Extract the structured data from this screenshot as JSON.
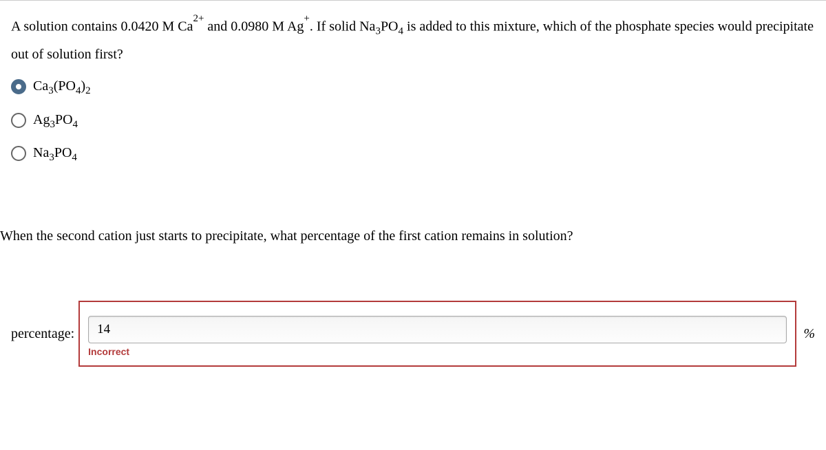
{
  "question1": {
    "prefix": "A solution contains 0.0420 M Ca",
    "sup1": "2+",
    "mid": " and 0.0980 M Ag",
    "sup2": "+",
    "suffix1": ". If solid Na",
    "sub1": "3",
    "suffix2": "PO",
    "sub2": "4",
    "suffix3": " is added to this mixture, which of the phosphate species would precipitate out of solution first?"
  },
  "options": [
    {
      "parts": [
        {
          "text": "Ca",
          "type": "normal"
        },
        {
          "text": "3",
          "type": "sub"
        },
        {
          "text": "(PO",
          "type": "normal"
        },
        {
          "text": "4",
          "type": "sub"
        },
        {
          "text": ")",
          "type": "normal"
        },
        {
          "text": "2",
          "type": "sub"
        }
      ],
      "selected": true
    },
    {
      "parts": [
        {
          "text": "Ag",
          "type": "normal"
        },
        {
          "text": "3",
          "type": "sub"
        },
        {
          "text": "PO",
          "type": "normal"
        },
        {
          "text": "4",
          "type": "sub"
        }
      ],
      "selected": false
    },
    {
      "parts": [
        {
          "text": "Na",
          "type": "normal"
        },
        {
          "text": "3",
          "type": "sub"
        },
        {
          "text": "PO",
          "type": "normal"
        },
        {
          "text": "4",
          "type": "sub"
        }
      ],
      "selected": false
    }
  ],
  "question2": "When the second cation just starts to precipitate, what percentage of the first cation remains in solution?",
  "answer": {
    "label": "percentage:",
    "value": "14",
    "unit": "%",
    "feedback": "Incorrect"
  }
}
